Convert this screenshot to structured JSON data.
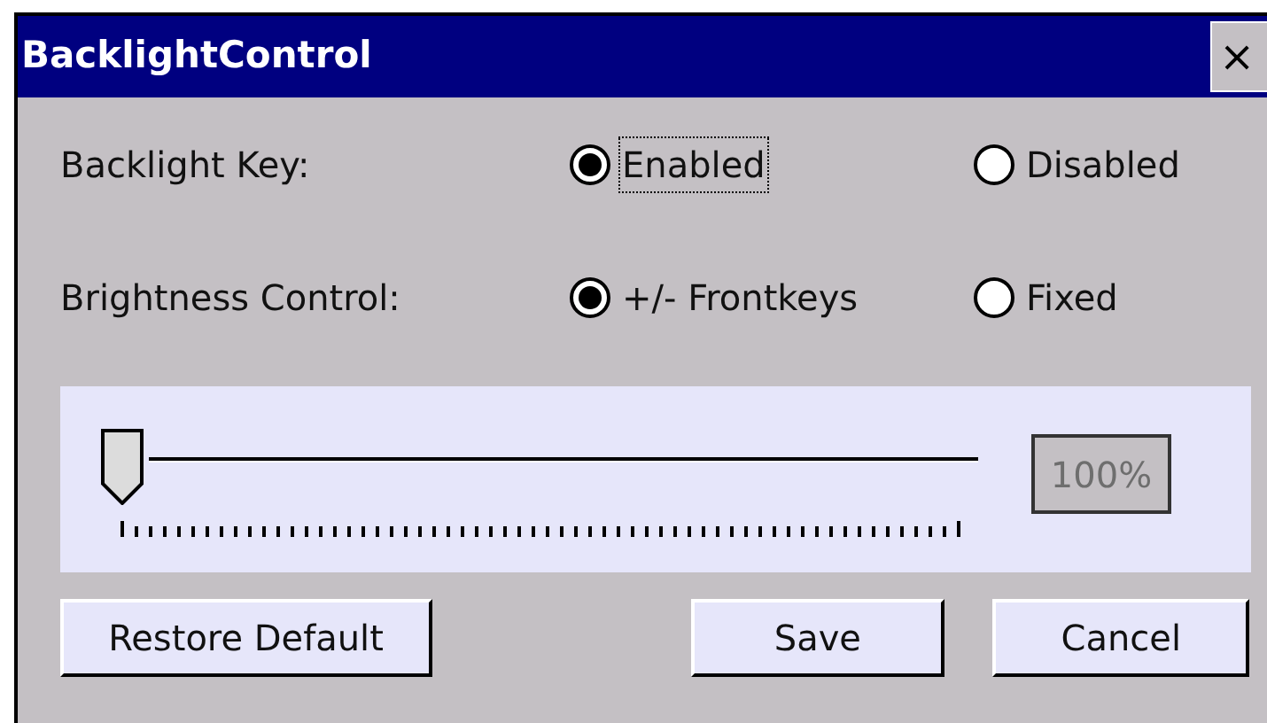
{
  "window": {
    "title": "BacklightControl",
    "close": "×"
  },
  "groups": [
    {
      "label": "Backlight Key:",
      "options": [
        {
          "label": "Enabled",
          "selected": true,
          "focused": true
        },
        {
          "label": "Disabled",
          "selected": false,
          "focused": false
        }
      ]
    },
    {
      "label": "Brightness Control:",
      "options": [
        {
          "label": "+/- Frontkeys",
          "selected": true,
          "focused": false
        },
        {
          "label": "Fixed",
          "selected": false,
          "focused": false
        }
      ]
    }
  ],
  "slider": {
    "level": 0,
    "reading": "100%",
    "reading_disabled": true
  },
  "buttons": [
    "Restore Default",
    "Save",
    "Cancel"
  ]
}
